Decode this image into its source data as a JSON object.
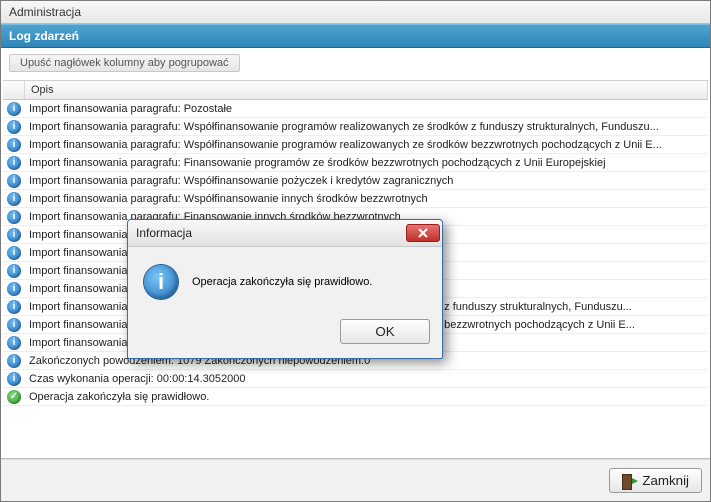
{
  "window": {
    "title": "Administracja"
  },
  "section": {
    "title": "Log zdarzeń"
  },
  "grid": {
    "group_hint": "Upuść nagłówek kolumny aby pogrupować",
    "columns": {
      "icon": "",
      "desc": "Opis"
    },
    "rows": [
      {
        "icon": "info",
        "text": "Import finansowania paragrafu: Pozostałe"
      },
      {
        "icon": "info",
        "text": "Import finansowania paragrafu: Współfinansowanie programów realizowanych ze środków z funduszy strukturalnych, Funduszu..."
      },
      {
        "icon": "info",
        "text": "Import finansowania paragrafu: Współfinansowanie programów realizowanych ze środków bezzwrotnych pochodzących z Unii E..."
      },
      {
        "icon": "info",
        "text": "Import finansowania paragrafu: Finansowanie programów ze środków bezzwrotnych pochodzących z Unii Europejskiej"
      },
      {
        "icon": "info",
        "text": "Import finansowania paragrafu: Współfinansowanie pożyczek i kredytów zagranicznych"
      },
      {
        "icon": "info",
        "text": "Import finansowania paragrafu: Współfinansowanie innych środków bezzwrotnych"
      },
      {
        "icon": "info",
        "text": "Import finansowania paragrafu: Finansowanie innych środków bezzwrotnych"
      },
      {
        "icon": "info",
        "text": "Import finansowania paragrafu: Finansowanie innych środków bezzwrotnych"
      },
      {
        "icon": "info",
        "text": "Import finansowania paragrafu: Finansowanie innych środków bezzwrotnych"
      },
      {
        "icon": "info",
        "text": "Import finansowania paragrafu: Finansowanie pożyczek i kredytów zagranicznych"
      },
      {
        "icon": "info",
        "text": "Import finansowania paragrafu: Finansowanie pożyczek i kredytów zagranicznych"
      },
      {
        "icon": "info",
        "text": "Import finansowania paragrafu: Finansowanie programów realizowanych ze środków z funduszy strukturalnych, Funduszu..."
      },
      {
        "icon": "info",
        "text": "Import finansowania paragrafu: Finansowanie programów realizowanych ze środków bezzwrotnych pochodzących z Unii E..."
      },
      {
        "icon": "info",
        "text": "Import finansowania paragrafu: Pozostałe"
      },
      {
        "icon": "info",
        "text": "Zakończonych powodzeniem: 1079 Zakończonych niepowodzeniem:0"
      },
      {
        "icon": "info",
        "text": "Czas wykonania operacji: 00:00:14.3052000"
      },
      {
        "icon": "ok",
        "text": "Operacja zakończyła się prawidłowo."
      }
    ]
  },
  "footer": {
    "close": "Zamknij"
  },
  "dialog": {
    "title": "Informacja",
    "message": "Operacja zakończyła się prawidłowo.",
    "ok": "OK"
  }
}
